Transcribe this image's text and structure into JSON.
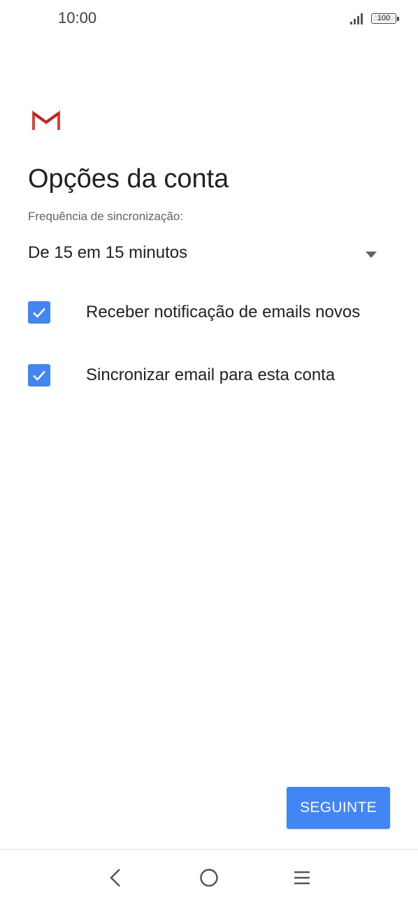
{
  "status_bar": {
    "time": "10:00",
    "battery": "100",
    "icons": [
      "signal-icon",
      "battery-icon"
    ]
  },
  "app": {
    "logo": "gmail-logo-icon"
  },
  "page": {
    "title": "Opções da conta"
  },
  "sync": {
    "label": "Frequência de sincronização:",
    "selected": "De 15 em 15 minutos",
    "icon": "dropdown-arrow-icon"
  },
  "options": [
    {
      "label": "Receber notificação de emails novos",
      "checked": true
    },
    {
      "label": "Sincronizar email para esta conta",
      "checked": true
    }
  ],
  "actions": {
    "next_label": "SEGUINTE"
  },
  "nav_bar": {
    "icons": [
      "back-icon",
      "home-icon",
      "menu-icon"
    ]
  },
  "colors": {
    "accent": "#4285f4",
    "gmail_red": "#d44638",
    "text_primary": "#202124",
    "text_secondary": "#5f6368"
  }
}
